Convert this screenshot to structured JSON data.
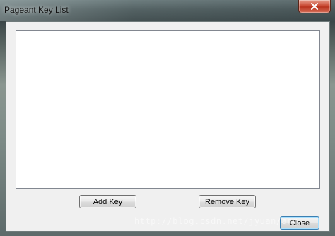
{
  "window": {
    "title": "Pageant Key List"
  },
  "buttons": {
    "add_key": "Add Key",
    "remove_key": "Remove Key",
    "close": "Close"
  },
  "watermark": "http://blog.csdn.net/jyuan/ang",
  "icons": {
    "window_close": "close-icon"
  },
  "colors": {
    "close_button": "#c94a33",
    "client_bg": "#f0f0f0",
    "list_bg": "#ffffff"
  }
}
